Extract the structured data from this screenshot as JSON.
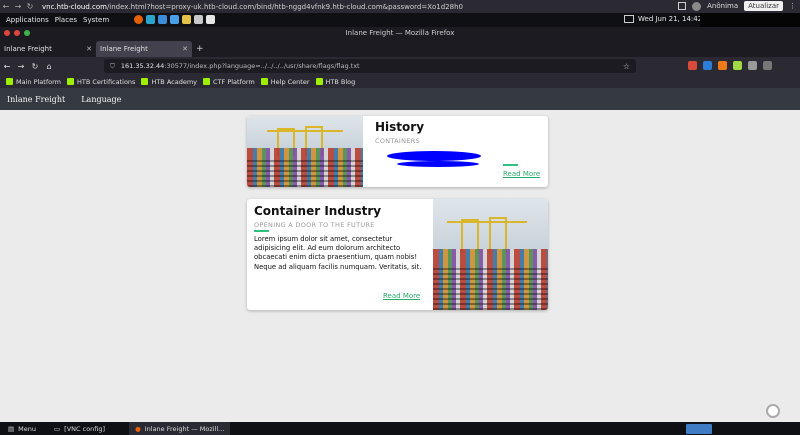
{
  "host_browser": {
    "url_prefix": "vnc.htb-cloud.com",
    "url_rest": "/index.html?host=proxy-uk.htb-cloud.com/bind/htb-nggd4vfnk9.htb-cloud.com&password=Xo1d28h0",
    "profile": "Anônima",
    "refresh_label": "Atualizar"
  },
  "panel": {
    "applications": "Applications",
    "places": "Places",
    "system": "System",
    "clock": "Wed Jun 21, 14:42"
  },
  "window": {
    "title": "Inlane Freight — Mozilla Firefox"
  },
  "tabs": [
    {
      "label": "Inlane Freight"
    },
    {
      "label": "Inlane Freight"
    }
  ],
  "address": {
    "host": "161.35.32.44",
    "rest": ":30577/index.php?language=../../../../usr/share/flags/flag.txt"
  },
  "bookmarks": [
    {
      "label": "Main Platform"
    },
    {
      "label": "HTB Certifications"
    },
    {
      "label": "HTB Academy"
    },
    {
      "label": "CTF Platform"
    },
    {
      "label": "Help Center"
    },
    {
      "label": "HTB Blog"
    }
  ],
  "site": {
    "brand": "Inlane Freight",
    "nav_language": "Language",
    "cards": [
      {
        "title": "History",
        "subtitle": "CONTAINERS",
        "read_more": "Read More"
      },
      {
        "title": "Container Industry",
        "subtitle": "OPENING A DOOR TO THE FUTURE",
        "body": "Lorem ipsum dolor sit amet, consectetur adipisicing elit. Ad eum dolorum architecto obcaecati enim dicta praesentium, quam nobis! Neque ad aliquam facilis numquam. Veritatis, sit.",
        "read_more": "Read More"
      }
    ]
  },
  "taskbar": {
    "menu": "Menu",
    "vnc": "[VNC config]",
    "firefox": "Inlane Freight — Mozill..."
  },
  "colors": {
    "accent_green": "#2ec27e",
    "nav_bg": "#343a40",
    "redaction": "#0000ff"
  }
}
